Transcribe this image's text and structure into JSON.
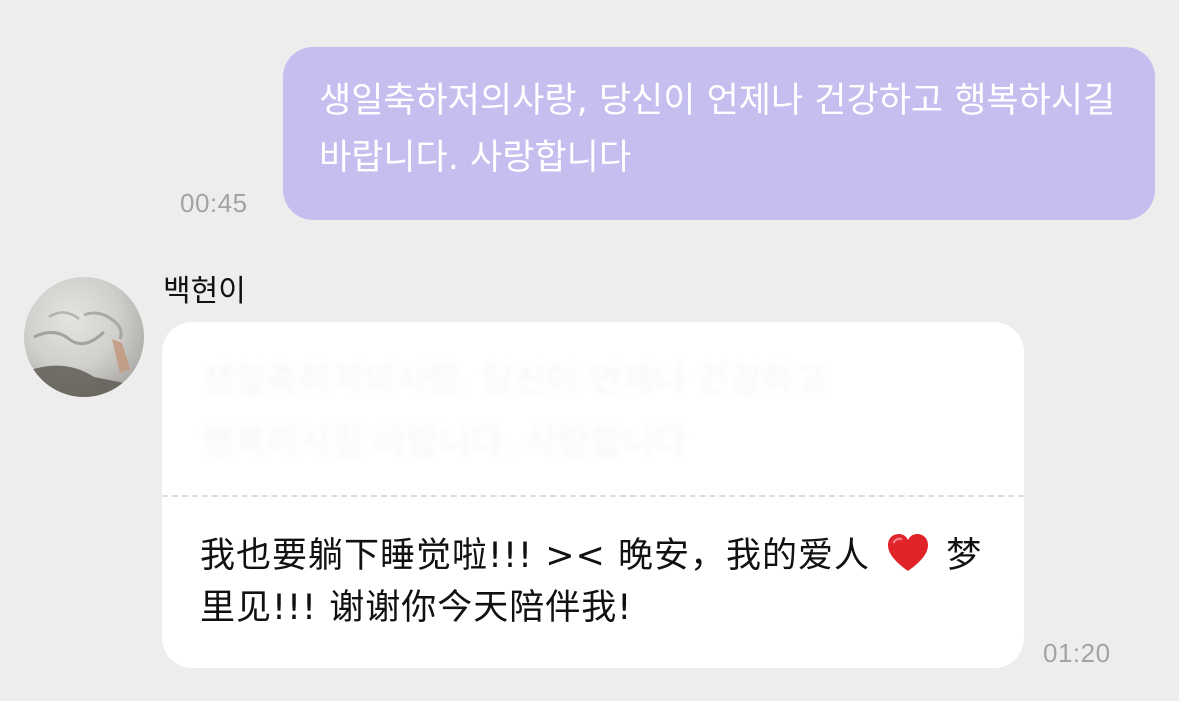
{
  "conversation": {
    "sent_message": {
      "text": "생일축하저의사랑, 당신이 언제나 건강하고 행복하시길 바랍니다. 사랑합니다",
      "time": "00:45"
    },
    "received_message": {
      "sender": "백현이",
      "reply_part1": "我也要躺下睡觉啦!!! >< 晚安，我的爱人",
      "reply_icon": "red-heart-icon",
      "reply_part2": " 梦里见!!! 谢谢你今天陪伴我!",
      "time": "01:20"
    }
  },
  "colors": {
    "background": "#ededed",
    "sent_bubble": "#c4bfee",
    "received_bubble": "#ffffff",
    "timestamp": "#a3a3a3",
    "heart": "#e0242a"
  }
}
